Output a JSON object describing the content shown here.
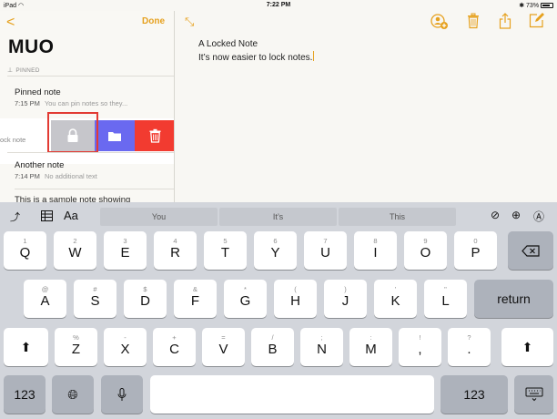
{
  "status_bar": {
    "device": "iPad",
    "time": "7:22 PM",
    "battery": "73%"
  },
  "sidebar": {
    "back_label": "<",
    "done_label": "Done",
    "title": "MUO",
    "pinned_header": "PINNED",
    "notes": [
      {
        "title": "Pinned note",
        "time": "7:15 PM",
        "preview": "You can pin notes so they..."
      },
      {
        "fragment": "ock note"
      },
      {
        "title": "Another note",
        "time": "7:14 PM",
        "preview": "No additional text"
      },
      {
        "title": "This is a sample note showing"
      }
    ],
    "swipe_actions": [
      {
        "name": "lock",
        "color": "#c6c6cb"
      },
      {
        "name": "move",
        "color": "#6a69f0"
      },
      {
        "name": "delete",
        "color": "#f23b30"
      }
    ]
  },
  "note": {
    "line1": "A Locked Note",
    "line2": "It’s now easier to lock notes."
  },
  "keyboard": {
    "suggestions": [
      "You",
      "It’s",
      "This"
    ],
    "row1": [
      {
        "alt": "1",
        "main": "Q"
      },
      {
        "alt": "2",
        "main": "W"
      },
      {
        "alt": "3",
        "main": "E"
      },
      {
        "alt": "4",
        "main": "R"
      },
      {
        "alt": "5",
        "main": "T"
      },
      {
        "alt": "6",
        "main": "Y"
      },
      {
        "alt": "7",
        "main": "U"
      },
      {
        "alt": "8",
        "main": "I"
      },
      {
        "alt": "9",
        "main": "O"
      },
      {
        "alt": "0",
        "main": "P"
      }
    ],
    "row2": [
      {
        "alt": "@",
        "main": "A"
      },
      {
        "alt": "#",
        "main": "S"
      },
      {
        "alt": "$",
        "main": "D"
      },
      {
        "alt": "&",
        "main": "F"
      },
      {
        "alt": "*",
        "main": "G"
      },
      {
        "alt": "(",
        "main": "H"
      },
      {
        "alt": ")",
        "main": "J"
      },
      {
        "alt": "’",
        "main": "K"
      },
      {
        "alt": "\"",
        "main": "L"
      }
    ],
    "return_label": "return",
    "row3": [
      {
        "alt": "%",
        "main": "Z"
      },
      {
        "alt": "-",
        "main": "X"
      },
      {
        "alt": "+",
        "main": "C"
      },
      {
        "alt": "=",
        "main": "V"
      },
      {
        "alt": "/",
        "main": "B"
      },
      {
        "alt": ";",
        "main": "N"
      },
      {
        "alt": ":",
        "main": "M"
      },
      {
        "alt": "!",
        "main": ","
      },
      {
        "alt": "?",
        "main": "."
      }
    ],
    "numbers_label": "123",
    "accent_color": "#e6a11e"
  }
}
